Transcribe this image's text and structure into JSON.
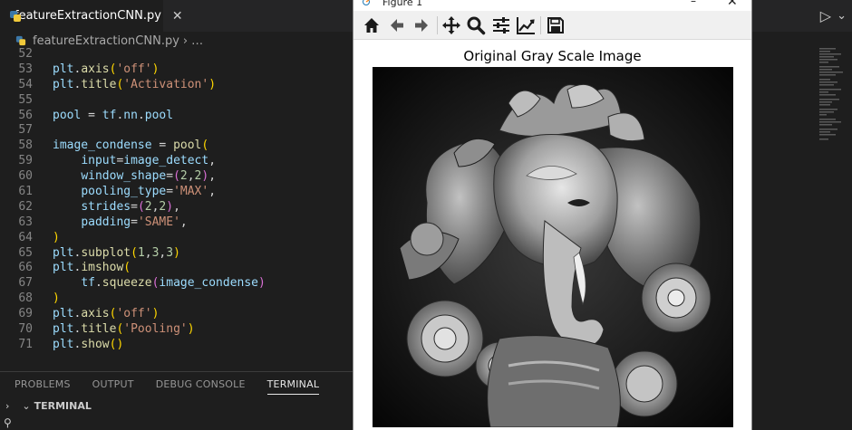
{
  "editor": {
    "tab": {
      "filename": "featureExtractionCNN.py",
      "close_glyph": "✕"
    },
    "run": {
      "play_glyph": "▷",
      "chevron_glyph": "⌄"
    },
    "breadcrumb": {
      "file": "featureExtractionCNN.py",
      "separator": "›",
      "more": "…"
    },
    "lines": [
      {
        "num": "52",
        "tokens": []
      },
      {
        "num": "53",
        "tokens": [
          [
            "var",
            "plt"
          ],
          [
            "p",
            "."
          ],
          [
            "fn",
            "axis"
          ],
          [
            "br1",
            "("
          ],
          [
            "str",
            "'off'"
          ],
          [
            "br1",
            ")"
          ]
        ]
      },
      {
        "num": "54",
        "tokens": [
          [
            "var",
            "plt"
          ],
          [
            "p",
            "."
          ],
          [
            "fn",
            "title"
          ],
          [
            "br1",
            "("
          ],
          [
            "str",
            "'Activation'"
          ],
          [
            "br1",
            ")"
          ]
        ]
      },
      {
        "num": "55",
        "tokens": []
      },
      {
        "num": "56",
        "tokens": [
          [
            "var",
            "pool"
          ],
          [
            "p",
            " = "
          ],
          [
            "var",
            "tf"
          ],
          [
            "p",
            "."
          ],
          [
            "var",
            "nn"
          ],
          [
            "p",
            "."
          ],
          [
            "var",
            "pool"
          ]
        ]
      },
      {
        "num": "57",
        "tokens": []
      },
      {
        "num": "58",
        "tokens": [
          [
            "var",
            "image_condense"
          ],
          [
            "p",
            " = "
          ],
          [
            "fn",
            "pool"
          ],
          [
            "br1",
            "("
          ]
        ]
      },
      {
        "num": "59",
        "tokens": [
          [
            "p",
            "    "
          ],
          [
            "var",
            "input"
          ],
          [
            "p",
            "="
          ],
          [
            "var",
            "image_detect"
          ],
          [
            "p",
            ","
          ]
        ]
      },
      {
        "num": "60",
        "tokens": [
          [
            "p",
            "    "
          ],
          [
            "var",
            "window_shape"
          ],
          [
            "p",
            "="
          ],
          [
            "br2",
            "("
          ],
          [
            "num",
            "2"
          ],
          [
            "p",
            ","
          ],
          [
            "num",
            "2"
          ],
          [
            "br2",
            ")"
          ],
          [
            "p",
            ","
          ]
        ]
      },
      {
        "num": "61",
        "tokens": [
          [
            "p",
            "    "
          ],
          [
            "var",
            "pooling_type"
          ],
          [
            "p",
            "="
          ],
          [
            "str",
            "'MAX'"
          ],
          [
            "p",
            ","
          ]
        ]
      },
      {
        "num": "62",
        "tokens": [
          [
            "p",
            "    "
          ],
          [
            "var",
            "strides"
          ],
          [
            "p",
            "="
          ],
          [
            "br2",
            "("
          ],
          [
            "num",
            "2"
          ],
          [
            "p",
            ","
          ],
          [
            "num",
            "2"
          ],
          [
            "br2",
            ")"
          ],
          [
            "p",
            ","
          ]
        ]
      },
      {
        "num": "63",
        "tokens": [
          [
            "p",
            "    "
          ],
          [
            "var",
            "padding"
          ],
          [
            "p",
            "="
          ],
          [
            "str",
            "'SAME'"
          ],
          [
            "p",
            ","
          ]
        ]
      },
      {
        "num": "64",
        "tokens": [
          [
            "br1",
            ")"
          ]
        ]
      },
      {
        "num": "65",
        "tokens": [
          [
            "var",
            "plt"
          ],
          [
            "p",
            "."
          ],
          [
            "fn",
            "subplot"
          ],
          [
            "br1",
            "("
          ],
          [
            "num",
            "1"
          ],
          [
            "p",
            ","
          ],
          [
            "num",
            "3"
          ],
          [
            "p",
            ","
          ],
          [
            "num",
            "3"
          ],
          [
            "br1",
            ")"
          ]
        ]
      },
      {
        "num": "66",
        "tokens": [
          [
            "var",
            "plt"
          ],
          [
            "p",
            "."
          ],
          [
            "fn",
            "imshow"
          ],
          [
            "br1",
            "("
          ]
        ]
      },
      {
        "num": "67",
        "tokens": [
          [
            "p",
            "    "
          ],
          [
            "var",
            "tf"
          ],
          [
            "p",
            "."
          ],
          [
            "fn",
            "squeeze"
          ],
          [
            "br2",
            "("
          ],
          [
            "var",
            "image_condense"
          ],
          [
            "br2",
            ")"
          ]
        ]
      },
      {
        "num": "68",
        "tokens": [
          [
            "br1",
            ")"
          ]
        ]
      },
      {
        "num": "69",
        "tokens": [
          [
            "var",
            "plt"
          ],
          [
            "p",
            "."
          ],
          [
            "fn",
            "axis"
          ],
          [
            "br1",
            "("
          ],
          [
            "str",
            "'off'"
          ],
          [
            "br1",
            ")"
          ]
        ]
      },
      {
        "num": "70",
        "tokens": [
          [
            "var",
            "plt"
          ],
          [
            "p",
            "."
          ],
          [
            "fn",
            "title"
          ],
          [
            "br1",
            "("
          ],
          [
            "str",
            "'Pooling'"
          ],
          [
            "br1",
            ")"
          ]
        ]
      },
      {
        "num": "71",
        "tokens": [
          [
            "var",
            "plt"
          ],
          [
            "p",
            "."
          ],
          [
            "fn",
            "show"
          ],
          [
            "br1",
            "("
          ],
          [
            "br1",
            ")"
          ]
        ]
      }
    ]
  },
  "panel": {
    "tabs": [
      "PROBLEMS",
      "OUTPUT",
      "DEBUG CONSOLE",
      "TERMINAL"
    ],
    "active_tab": "TERMINAL",
    "terminal_header": "TERMINAL",
    "terminal_prompt_glyph": "⚲"
  },
  "figure": {
    "window_title": "Figure 1",
    "toolbar": [
      "home-icon",
      "back-arrow-icon",
      "forward-arrow-icon",
      "pan-icon",
      "zoom-icon",
      "subplots-config-icon",
      "edit-axes-icon",
      "save-icon"
    ],
    "plot_title": "Original Gray Scale Image"
  },
  "colors": {
    "editor_bg": "#1e1e1e",
    "tabbar_bg": "#252526",
    "keyword_fn": "#dcdcaa",
    "variable": "#9cdcfe",
    "string": "#ce9178",
    "number": "#b5cea8"
  }
}
